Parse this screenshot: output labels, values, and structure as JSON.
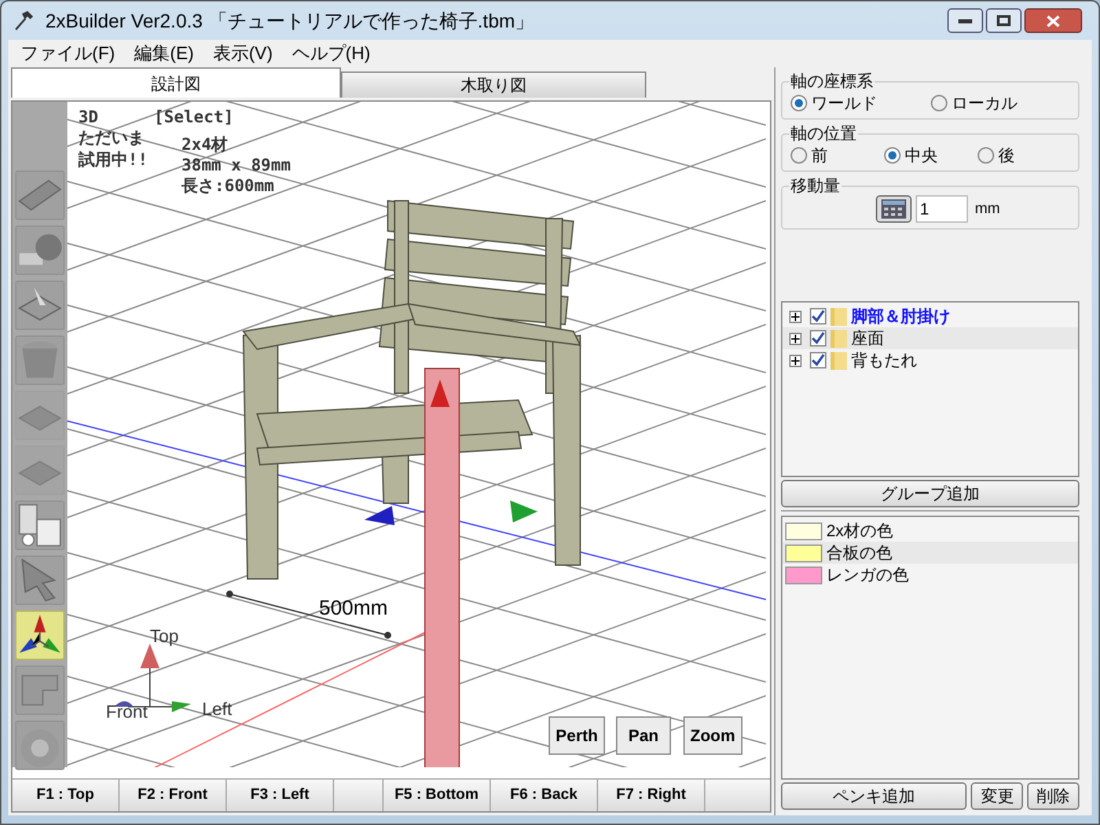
{
  "window": {
    "title": "2xBuilder Ver2.0.3 「チュートリアルで作った椅子.tbm」"
  },
  "menu": [
    "ファイル(F)",
    "編集(E)",
    "表示(V)",
    "ヘルプ(H)"
  ],
  "tabs": [
    {
      "label": "設計図",
      "selected": true
    },
    {
      "label": "木取り図",
      "selected": false
    }
  ],
  "viewport": {
    "mode": "3D",
    "tool": "[Select]",
    "notice": [
      "ただいま",
      "試用中!!"
    ],
    "part_info": [
      "2x4材",
      "38mm x 89mm",
      "長さ:600mm"
    ],
    "dimension": "500mm",
    "axis_labels": {
      "top": "Top",
      "front": "Front",
      "left": "Left"
    },
    "tools": [
      {
        "kind": "beam",
        "selected": false,
        "disabled": false
      },
      {
        "kind": "tape",
        "selected": false,
        "disabled": false
      },
      {
        "kind": "arrow-block",
        "selected": false,
        "disabled": false
      },
      {
        "kind": "bucket",
        "selected": false,
        "disabled": false
      },
      {
        "kind": "block",
        "selected": false,
        "disabled": true
      },
      {
        "kind": "block",
        "selected": false,
        "disabled": true
      },
      {
        "kind": "clamp",
        "selected": false,
        "disabled": false
      },
      {
        "kind": "pointer",
        "selected": false,
        "disabled": false
      },
      {
        "kind": "axes",
        "selected": true,
        "disabled": false
      },
      {
        "kind": "rotate",
        "selected": false,
        "disabled": false
      },
      {
        "kind": "wheel",
        "selected": false,
        "disabled": false
      }
    ],
    "view_buttons": [
      "Perth",
      "Pan",
      "Zoom"
    ],
    "function_keys": [
      "F1 : Top",
      "F2 : Front",
      "F3 : Left",
      "F5 : Bottom",
      "F6 : Back",
      "F7 : Right"
    ]
  },
  "axis_system": {
    "label": "軸の座標系",
    "options": [
      {
        "label": "ワールド",
        "selected": true
      },
      {
        "label": "ローカル",
        "selected": false
      }
    ]
  },
  "axis_position": {
    "label": "軸の位置",
    "options": [
      {
        "label": "前",
        "selected": false
      },
      {
        "label": "中央",
        "selected": true
      },
      {
        "label": "後",
        "selected": false
      }
    ]
  },
  "move_amount": {
    "label": "移動量",
    "value": "1",
    "unit": "mm"
  },
  "groups": [
    {
      "label": "脚部＆肘掛け",
      "checked": true,
      "selected": true
    },
    {
      "label": "座面",
      "checked": true,
      "selected": false
    },
    {
      "label": "背もたれ",
      "checked": true,
      "selected": false
    }
  ],
  "add_group_button": "グループ追加",
  "paints": [
    {
      "label": "2x材の色",
      "color": "#ffffe0"
    },
    {
      "label": "合板の色",
      "color": "#ffff99"
    },
    {
      "label": "レンガの色",
      "color": "#ff99cc"
    }
  ],
  "paint_buttons": [
    "ペンキ追加",
    "変更",
    "削除"
  ]
}
